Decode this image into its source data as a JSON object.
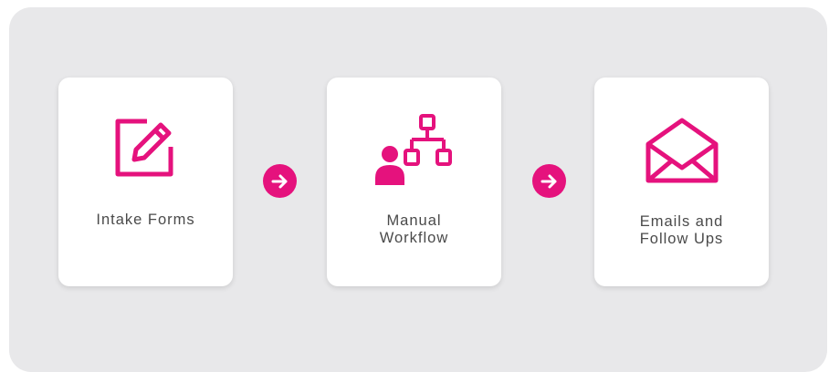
{
  "steps": [
    {
      "label": "Intake Forms",
      "icon": "edit-form-icon"
    },
    {
      "label": "Manual\nWorkflow",
      "icon": "person-workflow-icon"
    },
    {
      "label": "Emails and\nFollow Ups",
      "icon": "open-envelope-icon"
    }
  ],
  "connector_icon": "arrow-right-circle-icon",
  "colors": {
    "accent": "#e5127d",
    "panel": "#e8e8ea",
    "card": "#ffffff",
    "text": "#4a4a4a"
  }
}
